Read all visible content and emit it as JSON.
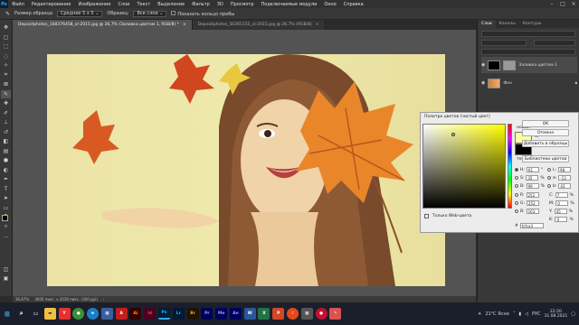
{
  "menubar": {
    "items": [
      "Файл",
      "Редактирование",
      "Изображение",
      "Слои",
      "Текст",
      "Выделение",
      "Фильтр",
      "3D",
      "Просмотр",
      "Подключаемые модули",
      "Окно",
      "Справка"
    ]
  },
  "optionsbar": {
    "brush_size": "Размер образца",
    "sample": "Среднее 5 х 5",
    "sample_layers": "Образец:",
    "all_layers": "Все слои",
    "show_ring": "Показать кольцо пробы"
  },
  "tabs": [
    {
      "label": "Depositphotos_168376458_xl-2015.jpg @ 36,7% (Заливка цветом 1, RGB/8) *"
    },
    {
      "label": "Depositphotos_50365155_xl-2015.jpg @ 26,7% (RGB/8)"
    }
  ],
  "status": {
    "zoom": "36,67%",
    "doc": "3600 пикс. x 2039 пикс. (300 ppi)"
  },
  "panels": {
    "tabs": [
      "Слои",
      "Каналы",
      "Контуры"
    ],
    "top_tabs": [
      "Слои",
      "Каналы",
      "Контуры"
    ],
    "layers": [
      {
        "name": "Заливка цветом 1"
      },
      {
        "name": "Фон"
      }
    ]
  },
  "color_picker": {
    "title": "Палитра цветов (чистый цвет)",
    "new_label": "новый",
    "current_label": "текущий",
    "ok": "OK",
    "cancel": "Отмена",
    "add_swatch": "Добавить в образцы",
    "libraries": "Библиотеки цветов",
    "web_only": "Только Web-цвета",
    "h": {
      "label": "H:",
      "value": "61",
      "unit": "°"
    },
    "s": {
      "label": "S:",
      "value": "35",
      "unit": "%"
    },
    "b": {
      "label": "B:",
      "value": "99",
      "unit": "%"
    },
    "r": {
      "label": "R:",
      "value": "252"
    },
    "g": {
      "label": "G:",
      "value": "252"
    },
    "bb": {
      "label": "B:",
      "value": "163"
    },
    "l": {
      "label": "L:",
      "value": "98"
    },
    "a": {
      "label": "a:",
      "value": "-13"
    },
    "b2": {
      "label": "b:",
      "value": "43"
    },
    "c": {
      "label": "C:",
      "value": "7",
      "unit": "%"
    },
    "m": {
      "label": "M:",
      "value": "0",
      "unit": "%"
    },
    "y": {
      "label": "Y:",
      "value": "45",
      "unit": "%"
    },
    "k": {
      "label": "K:",
      "value": "0",
      "unit": "%"
    },
    "hex_label": "#",
    "hex": "fcfca3"
  },
  "taskbar": {
    "temp": "21°C Ясно",
    "time": "22:20",
    "date": "31.08.2021",
    "lang": "РУС"
  },
  "colors": {
    "accent": "#31a8ff",
    "new_color": "#fcfca3",
    "current_color": "#000000"
  }
}
